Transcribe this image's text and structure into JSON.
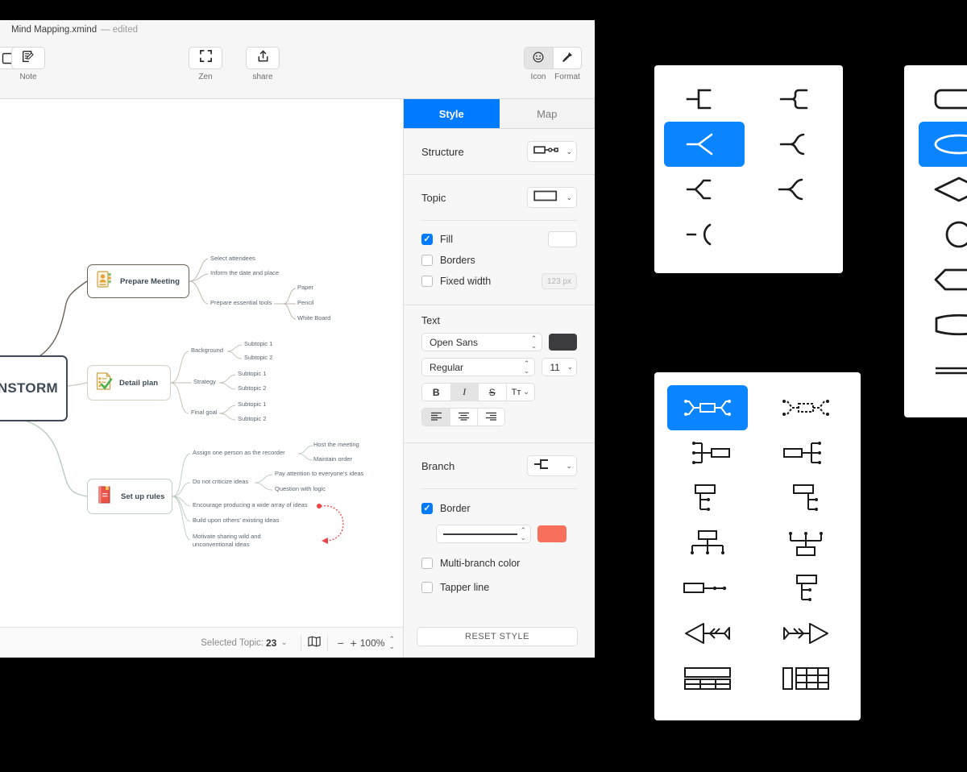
{
  "window": {
    "title": "Mind Mapping.xmind",
    "edited_suffix": "— edited"
  },
  "toolbar": {
    "buttons": [
      {
        "name": "note",
        "label": "Note",
        "icon": "note-edit-icon"
      },
      {
        "name": "zen",
        "label": "Zen",
        "icon": "fullscreen-icon"
      },
      {
        "name": "share",
        "label": "share",
        "icon": "share-upload-icon"
      }
    ],
    "segments": [
      {
        "name": "icon",
        "label": "Icon",
        "glyph": "☺",
        "selected": true
      },
      {
        "name": "format",
        "label": "Format",
        "glyph": "✇",
        "selected": false
      }
    ]
  },
  "statusbar": {
    "selected_topic_label": "Selected Topic:",
    "selected_topic_count": "23",
    "chevron": "⌄",
    "map_icon": "book-map-icon",
    "zoom_minus": "−",
    "zoom_plus": "+",
    "zoom_value": "100%",
    "zoom_stepper": "⌃⌄"
  },
  "panel": {
    "tabs": [
      {
        "label": "Style",
        "active": true
      },
      {
        "label": "Map",
        "active": false
      }
    ],
    "structure": {
      "label": "Structure",
      "icon": "structure-right-logic-icon",
      "chevron": "⌄"
    },
    "topic": {
      "label": "Topic",
      "icon": "rectangle-shape-icon",
      "chevron": "⌄"
    },
    "fill": {
      "label": "Fill",
      "checked": true,
      "color": "#ffffff"
    },
    "borders": {
      "label": "Borders",
      "checked": false
    },
    "fixed_width": {
      "label": "Fixed width",
      "checked": false,
      "placeholder": "123 px"
    },
    "text": {
      "section_label": "Text",
      "font_family": "Open Sans",
      "font_color": "#3b3b40",
      "font_style": "Regular",
      "font_size": "11",
      "bold": "B",
      "italic": "I",
      "strike": "S",
      "case": "Tт",
      "case_chevron": "⌄",
      "align_left": "left-align-icon",
      "align_center": "center-align-icon",
      "align_right": "right-align-icon",
      "bold_on": false,
      "italic_on": true,
      "align_selected": "left"
    },
    "branch": {
      "label": "Branch",
      "icon": "branch-elbow-icon",
      "chevron": "⌄",
      "border": {
        "label": "Border",
        "checked": true
      },
      "line_color": "#f8705c",
      "multi_branch_color": {
        "label": "Multi-branch color",
        "checked": false
      },
      "tapper_line": {
        "label": "Tapper line",
        "checked": false
      }
    },
    "reset_label": "RESET STYLE"
  },
  "pickers": {
    "branch": {
      "name": "branch-style-picker",
      "selected_index": 2,
      "items": [
        "branch-square-elbow",
        "branch-rounded-elbow",
        "branch-straight-fork",
        "branch-curve-fork",
        "branch-angled-fork",
        "branch-wide-fork",
        "branch-arc"
      ]
    },
    "topic": {
      "name": "topic-shape-picker",
      "selected_index": 1,
      "items": [
        "shape-rounded-rect",
        "shape-ellipse",
        "shape-diamond",
        "shape-circle",
        "shape-pentagon-left",
        "shape-capsule",
        "shape-underline"
      ]
    },
    "structure": {
      "name": "structure-picker",
      "selected_index": 0,
      "items": [
        "structure-balanced-map",
        "structure-balanced-map-alt",
        "structure-logic-left",
        "structure-logic-right",
        "structure-tree-right",
        "structure-tree-left",
        "structure-org-down",
        "structure-org-up",
        "structure-timeline-right",
        "structure-tree-down",
        "structure-fishbone-left",
        "structure-fishbone-right",
        "structure-matrix-row",
        "structure-matrix-col"
      ]
    }
  },
  "mindmap": {
    "root": {
      "label": "BRAINSTORM"
    },
    "branches": [
      {
        "label": "Prepare Meeting",
        "icon": "contact-card-icon",
        "children": [
          {
            "label": "Select attendees",
            "children": []
          },
          {
            "label": "Inform the date and place",
            "children": []
          },
          {
            "label": "Prepare essential tools",
            "children": [
              "Paper",
              "Pencil",
              "White Board"
            ]
          }
        ]
      },
      {
        "label": "Detail plan",
        "icon": "checklist-icon",
        "children": [
          {
            "label": "Background",
            "children": [
              "Subtopic 1",
              "Subtopic 2"
            ]
          },
          {
            "label": "Strategy",
            "children": [
              "Subtopic 1",
              "Subtopic 2"
            ]
          },
          {
            "label": "Final goal",
            "children": [
              "Subtopic 1",
              "Subtopic 2"
            ]
          }
        ]
      },
      {
        "label": "Set up rules",
        "icon": "red-book-icon",
        "children": [
          {
            "label": "Assign one person as the recorder",
            "children": [
              "Host the meeting",
              "Maintain order"
            ]
          },
          {
            "label": "Do not criticize ideas",
            "children": [
              "Pay attention to everyone's ideas",
              "Question with logic"
            ]
          },
          {
            "label": "Encourage producing a wide array of ideas",
            "children": []
          },
          {
            "label": "Build upon others' existing ideas",
            "children": []
          },
          {
            "label": "Motivate sharing wild and unconventional ideas",
            "children": []
          }
        ]
      }
    ],
    "relationship_color": "#ee4444"
  }
}
